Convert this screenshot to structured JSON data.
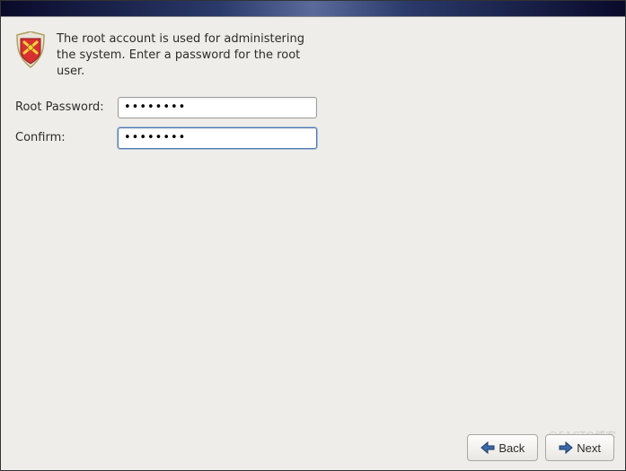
{
  "intro": {
    "text": "The root account is used for administering the system.  Enter a password for the root user."
  },
  "form": {
    "root_password_label": "Root Password:",
    "root_password_value": "••••••••",
    "confirm_label": "Confirm:",
    "confirm_value": "••••••••"
  },
  "buttons": {
    "back_label": "Back",
    "next_label": "Next"
  },
  "icons": {
    "back_arrow": "back-arrow-icon",
    "next_arrow": "next-arrow-icon",
    "shield": "root-shield-icon"
  }
}
